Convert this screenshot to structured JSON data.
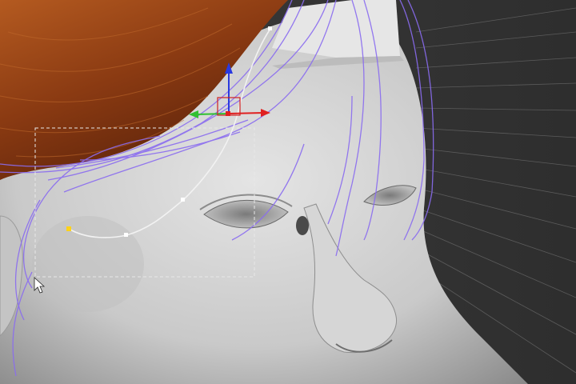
{
  "viewport": {
    "view": "3d-perspective",
    "background_color": "#3a3a3a",
    "grid_color": "#7a7a7a"
  },
  "model": {
    "subject": "head-mesh",
    "skin_color": "#d2d2d2",
    "hair_color": "#8a3a12",
    "guide_curve_color": "#8a6cf0"
  },
  "tools": {
    "active": "marquee-select",
    "gizmo": "move-gizmo",
    "axis_colors": {
      "x": "#e02020",
      "y": "#30c030",
      "z": "#2a3ae0"
    },
    "control_point_color": "#ffffff",
    "selected_point_color": "#ffd21a"
  }
}
